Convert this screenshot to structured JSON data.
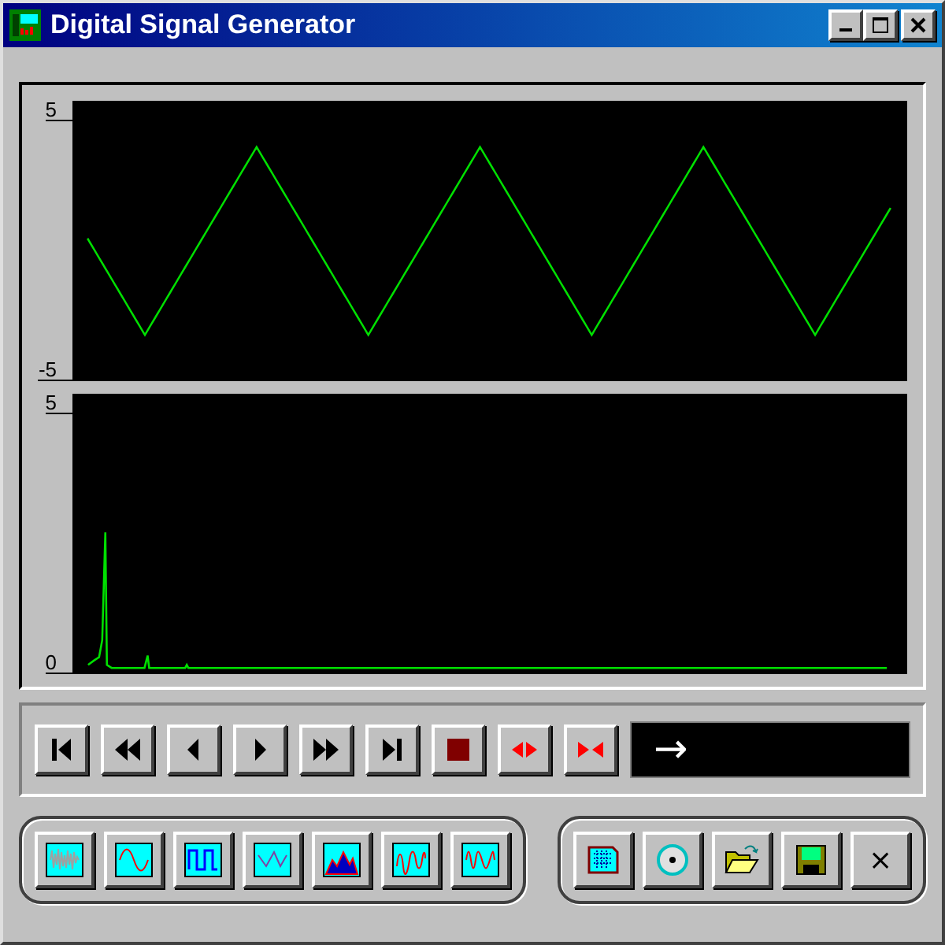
{
  "window": {
    "title": "Digital Signal Generator"
  },
  "plots": [
    {
      "kind": "wave",
      "y_max": "5",
      "y_min": "-5"
    },
    {
      "kind": "spectrum",
      "y_max": "5",
      "y_min": "0"
    }
  ],
  "transport": [
    {
      "kind": "first"
    },
    {
      "kind": "rewind"
    },
    {
      "kind": "prev"
    },
    {
      "kind": "play"
    },
    {
      "kind": "forward"
    },
    {
      "kind": "last"
    },
    {
      "kind": "stop"
    },
    {
      "kind": "spread"
    },
    {
      "kind": "squeeze"
    }
  ],
  "display": {
    "text": "→"
  },
  "waveforms": [
    {
      "kind": "noise"
    },
    {
      "kind": "sine"
    },
    {
      "kind": "square"
    },
    {
      "kind": "triangle"
    },
    {
      "kind": "area"
    },
    {
      "kind": "am"
    },
    {
      "kind": "fm"
    }
  ],
  "file_buttons": [
    {
      "kind": "table"
    },
    {
      "kind": "disc"
    },
    {
      "kind": "open"
    },
    {
      "kind": "save"
    },
    {
      "kind": "close",
      "text": "×"
    }
  ]
}
